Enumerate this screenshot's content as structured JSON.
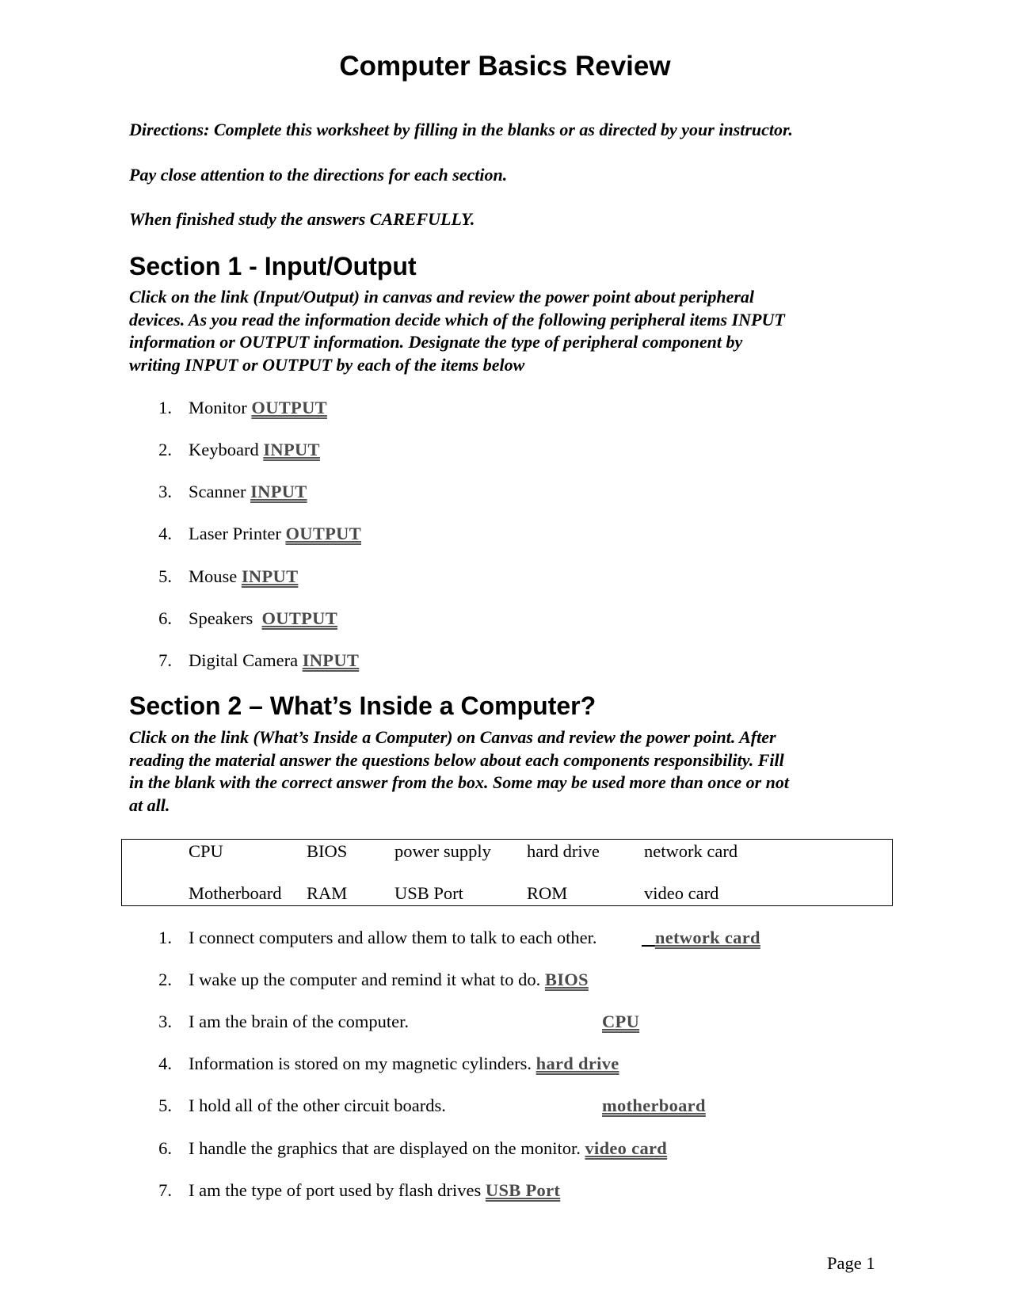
{
  "document": {
    "title": "Computer Basics Review",
    "directions": [
      "Directions:  Complete this worksheet by filling in the blanks or as directed by your instructor.",
      "Pay close attention to the directions for each section.",
      "When finished study the answers CAREFULLY."
    ],
    "page_label": "Page 1"
  },
  "section1": {
    "heading": "Section 1 - Input/Output",
    "instructions": [
      "Click on the link (Input/Output) in canvas and review the power point about peripheral",
      "devices.  As you read the information decide which of the following peripheral  items INPUT",
      "information or OUTPUT information.  Designate the type of peripheral component by",
      "writing INPUT or OUTPUT by each of the items below"
    ],
    "items": [
      {
        "num": "1.",
        "label": "Monitor",
        "answer": "OUTPUT"
      },
      {
        "num": "2.",
        "label": "Keyboard",
        "answer": "INPUT"
      },
      {
        "num": "3.",
        "label": "Scanner",
        "answer": "INPUT"
      },
      {
        "num": "4.",
        "label": "Laser Printer",
        "answer": "OUTPUT"
      },
      {
        "num": "5.",
        "label": "Mouse",
        "answer": "INPUT"
      },
      {
        "num": "6.",
        "label": "Speakers",
        "answer": "OUTPUT"
      },
      {
        "num": "7.",
        "label": "Digital Camera",
        "answer": "INPUT"
      }
    ]
  },
  "section2": {
    "heading": "Section 2 – What’s Inside a Computer?",
    "instructions": [
      "Click on the link (What’s Inside a Computer) on Canvas and review the power point. After",
      "reading the material answer the questions below about each components responsibility.   Fill",
      "in the blank with the correct answer from the box.  Some may be used more than once or not",
      "at all."
    ],
    "word_bank": {
      "row1": [
        "CPU",
        "BIOS",
        "power supply",
        "hard drive",
        "network card"
      ],
      "row2": [
        "Motherboard",
        "RAM",
        "USB Port",
        "ROM",
        "video card"
      ]
    },
    "questions": [
      {
        "num": "1.",
        "text": "I connect computers and allow them to talk to each other.",
        "answer": "network card"
      },
      {
        "num": "2.",
        "text": "I wake up the computer and remind it what to do.",
        "answer": "BIOS"
      },
      {
        "num": "3.",
        "text": "I am the brain of the computer.",
        "answer": "CPU"
      },
      {
        "num": "4.",
        "text": "Information is stored on my magnetic cylinders.",
        "answer": "hard drive"
      },
      {
        "num": "5.",
        "text": "I hold all of the other circuit boards.",
        "answer": "motherboard"
      },
      {
        "num": "6.",
        "text": "I handle the graphics that are displayed on the monitor.",
        "answer": "video card"
      },
      {
        "num": "7.",
        "text": "I am the type of port used by flash drives",
        "answer": "USB Port"
      }
    ]
  }
}
